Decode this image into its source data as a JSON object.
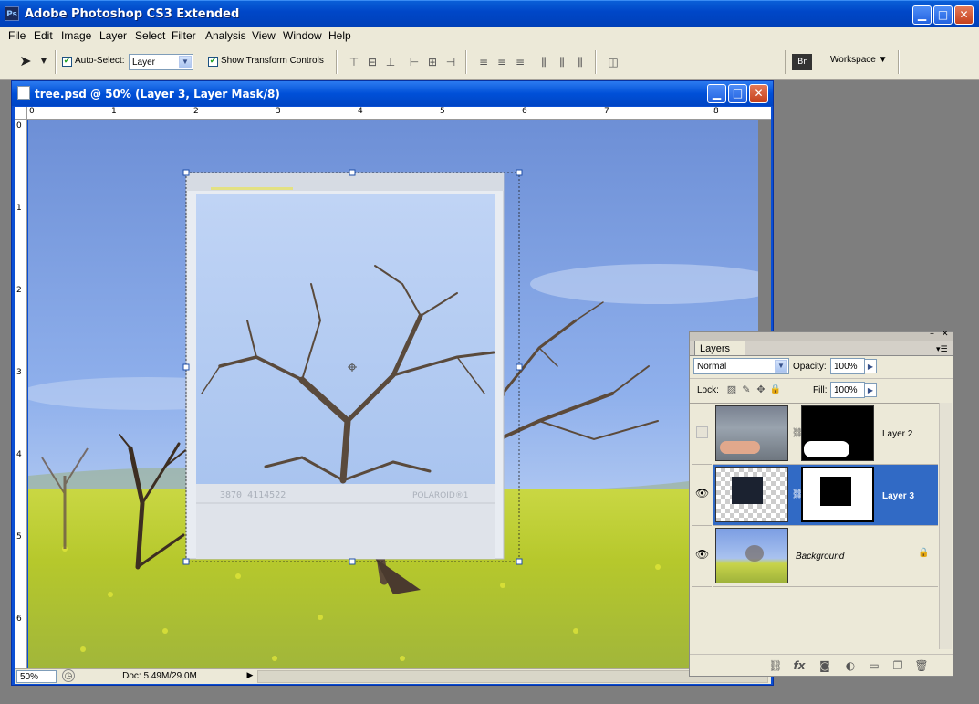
{
  "app": {
    "title": "Adobe Photoshop CS3 Extended",
    "icon": "Ps",
    "menu": [
      "File",
      "Edit",
      "Image",
      "Layer",
      "Select",
      "Filter",
      "Analysis",
      "View",
      "Window",
      "Help"
    ]
  },
  "options": {
    "auto_select_label": "Auto-Select:",
    "auto_select_checked": true,
    "auto_select_value": "Layer",
    "transform_label": "Show Transform Controls",
    "transform_checked": true,
    "workspace_label": "Workspace"
  },
  "document": {
    "title": "tree.psd @ 50% (Layer 3, Layer Mask/8)",
    "hruler_ticks": [
      "0",
      "1",
      "2",
      "3",
      "4",
      "5",
      "6",
      "7",
      "8"
    ],
    "vruler_ticks": [
      "0",
      "1",
      "2",
      "3",
      "4",
      "5",
      "6"
    ],
    "zoom": "50%",
    "doc_size": "Doc: 5.49M/29.0M",
    "polaroid_text": "POLAROID®1",
    "polaroid_code": "3870 4114522"
  },
  "layers_panel": {
    "tab_label": "Layers",
    "blend_mode": "Normal",
    "opacity_label": "Opacity:",
    "opacity_value": "100%",
    "lock_label": "Lock:",
    "fill_label": "Fill:",
    "fill_value": "100%",
    "layers": [
      {
        "name": "Layer 2",
        "visible": false,
        "selected": false
      },
      {
        "name": "Layer 3",
        "visible": true,
        "selected": true
      },
      {
        "name": "Background",
        "visible": true,
        "selected": false,
        "locked": true
      }
    ]
  },
  "colors": {
    "title_blue": "#0050d8",
    "panel_bg": "#ece9d8",
    "selected_layer": "#316ac5"
  }
}
